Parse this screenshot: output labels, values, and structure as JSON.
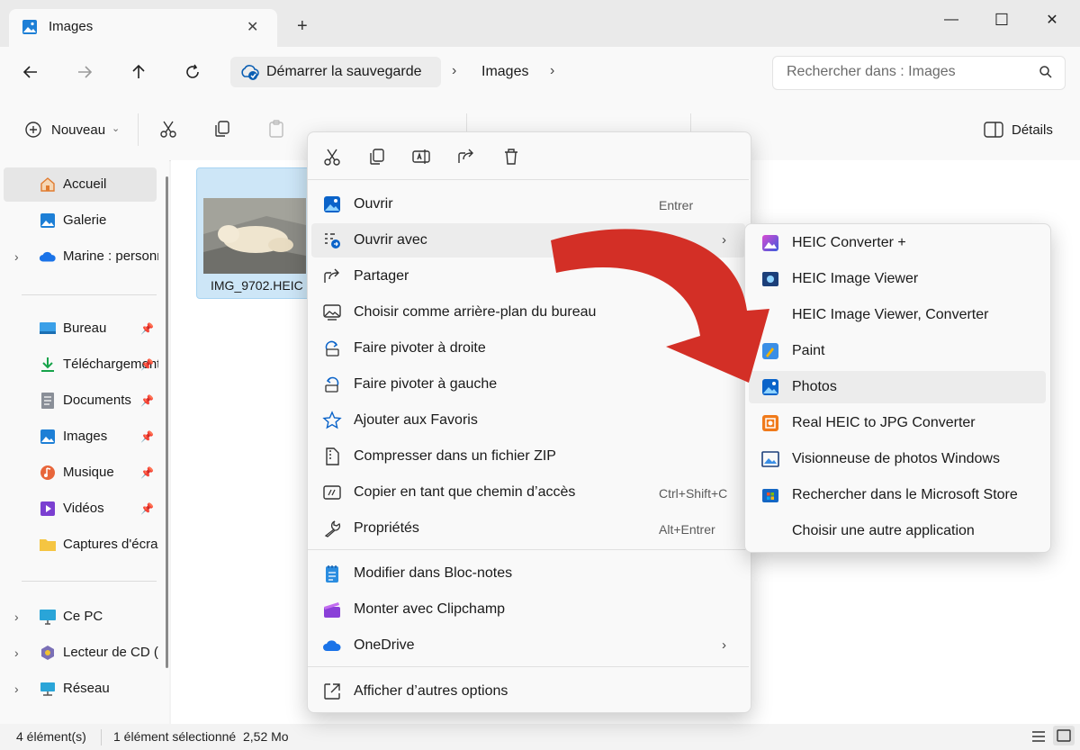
{
  "window": {
    "tab_title": "Images",
    "tab_close": "✕",
    "new_tab": "+",
    "minimize": "—",
    "maximize": "☐",
    "close": "✕"
  },
  "address": {
    "breadcrumb_root": "Démarrer la sauvegarde",
    "breadcrumb_current": "Images",
    "separator": "›",
    "search_placeholder": "Rechercher dans : Images"
  },
  "toolbar": {
    "new_label": "Nouveau",
    "details_label": "Détails"
  },
  "sidebar": {
    "items": [
      {
        "label": "Accueil",
        "icon": "home-icon"
      },
      {
        "label": "Galerie",
        "icon": "gallery-icon"
      },
      {
        "label": "Marine : personnel",
        "icon": "onedrive-icon"
      },
      {
        "label": "Bureau",
        "icon": "desktop-icon"
      },
      {
        "label": "Téléchargements",
        "icon": "download-icon"
      },
      {
        "label": "Documents",
        "icon": "documents-icon"
      },
      {
        "label": "Images",
        "icon": "pictures-icon"
      },
      {
        "label": "Musique",
        "icon": "music-icon"
      },
      {
        "label": "Vidéos",
        "icon": "videos-icon"
      },
      {
        "label": "Captures d'écran",
        "icon": "folder-icon"
      },
      {
        "label": "Ce PC",
        "icon": "pc-icon"
      },
      {
        "label": "Lecteur de CD (D:)",
        "icon": "cd-drive-icon"
      },
      {
        "label": "Réseau",
        "icon": "network-icon"
      }
    ]
  },
  "files": [
    {
      "name": "IMG_9702.HEIC"
    }
  ],
  "status": {
    "count": "4 élément(s)",
    "selection": "1 élément sélectionné  2,52 Mo"
  },
  "context_menu": {
    "items": [
      {
        "label": "Ouvrir",
        "shortcut": "Entrer",
        "icon": "photos-icon"
      },
      {
        "label": "Ouvrir avec",
        "shortcut": "",
        "icon": "open-with-icon"
      },
      {
        "label": "Partager",
        "shortcut": "",
        "icon": "share-icon"
      },
      {
        "label": "Choisir comme arrière-plan du bureau",
        "shortcut": "",
        "icon": "wallpaper-icon"
      },
      {
        "label": "Faire pivoter à droite",
        "shortcut": "",
        "icon": "rotate-right-icon"
      },
      {
        "label": "Faire pivoter à gauche",
        "shortcut": "",
        "icon": "rotate-left-icon"
      },
      {
        "label": "Ajouter aux Favoris",
        "shortcut": "",
        "icon": "star-icon"
      },
      {
        "label": "Compresser dans un fichier ZIP",
        "shortcut": "",
        "icon": "zip-icon"
      },
      {
        "label": "Copier en tant que chemin d’accès",
        "shortcut": "Ctrl+Shift+C",
        "icon": "copy-path-icon"
      },
      {
        "label": "Propriétés",
        "shortcut": "Alt+Entrer",
        "icon": "wrench-icon"
      },
      {
        "label": "Modifier dans Bloc-notes",
        "shortcut": "",
        "icon": "notepad-icon"
      },
      {
        "label": "Monter avec Clipchamp",
        "shortcut": "",
        "icon": "clipchamp-icon"
      },
      {
        "label": "OneDrive",
        "shortcut": "",
        "icon": "onedrive-icon"
      },
      {
        "label": "Afficher d’autres options",
        "shortcut": "",
        "icon": "more-options-icon"
      }
    ]
  },
  "submenu": {
    "items": [
      {
        "label": "HEIC Converter +",
        "icon": "heic-converter-icon"
      },
      {
        "label": "HEIC Image Viewer",
        "icon": "heic-viewer-icon"
      },
      {
        "label": "HEIC Image Viewer, Converter",
        "icon": "blank-icon"
      },
      {
        "label": "Paint",
        "icon": "paint-icon"
      },
      {
        "label": "Photos",
        "icon": "photos-icon"
      },
      {
        "label": "Real HEIC to JPG Converter",
        "icon": "real-heic-icon"
      },
      {
        "label": "Visionneuse de photos Windows",
        "icon": "photo-viewer-icon"
      },
      {
        "label": "Rechercher dans le Microsoft Store",
        "icon": "store-icon"
      },
      {
        "label": "Choisir une autre application",
        "icon": "blank-icon"
      }
    ]
  },
  "colors": {
    "accent": "#0067c0",
    "arrow": "#d32f26",
    "selection": "#cde6f7"
  }
}
